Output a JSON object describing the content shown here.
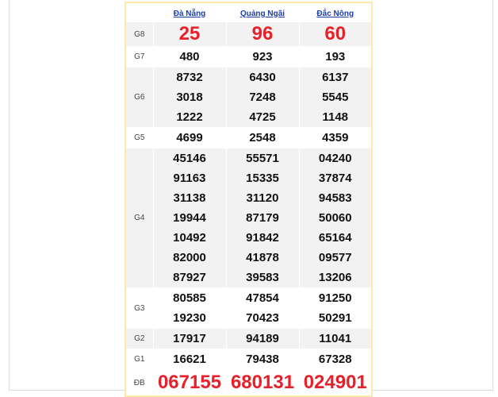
{
  "provinces": [
    "Đà Nẵng",
    "Quảng Ngãi",
    "Đắc Nông"
  ],
  "prizes": [
    {
      "label": "G8",
      "values": [
        [
          "25"
        ],
        [
          "96"
        ],
        [
          "60"
        ]
      ]
    },
    {
      "label": "G7",
      "values": [
        [
          "480"
        ],
        [
          "923"
        ],
        [
          "193"
        ]
      ]
    },
    {
      "label": "G6",
      "values": [
        [
          "8732",
          "3018",
          "1222"
        ],
        [
          "6430",
          "7248",
          "4725"
        ],
        [
          "6137",
          "5545",
          "1148"
        ]
      ]
    },
    {
      "label": "G5",
      "values": [
        [
          "4699"
        ],
        [
          "2548"
        ],
        [
          "4359"
        ]
      ]
    },
    {
      "label": "G4",
      "values": [
        [
          "45146",
          "91163",
          "31138",
          "19944",
          "10492",
          "82000",
          "87927"
        ],
        [
          "55571",
          "15335",
          "31120",
          "87179",
          "91842",
          "41878",
          "39583"
        ],
        [
          "04240",
          "37874",
          "94583",
          "50060",
          "65164",
          "09577",
          "13206"
        ]
      ]
    },
    {
      "label": "G3",
      "values": [
        [
          "80585",
          "19230"
        ],
        [
          "47854",
          "70423"
        ],
        [
          "91250",
          "50291"
        ]
      ]
    },
    {
      "label": "G2",
      "values": [
        [
          "17917"
        ],
        [
          "94189"
        ],
        [
          "11041"
        ]
      ]
    },
    {
      "label": "G1",
      "values": [
        [
          "16621"
        ],
        [
          "79438"
        ],
        [
          "67328"
        ]
      ]
    },
    {
      "label": "ĐB",
      "values": [
        [
          "067155"
        ],
        [
          "680131"
        ],
        [
          "024901"
        ]
      ]
    }
  ],
  "colors": {
    "highlight": "#e8202a",
    "link": "#1a3ea8",
    "border": "#ffe9a8"
  }
}
